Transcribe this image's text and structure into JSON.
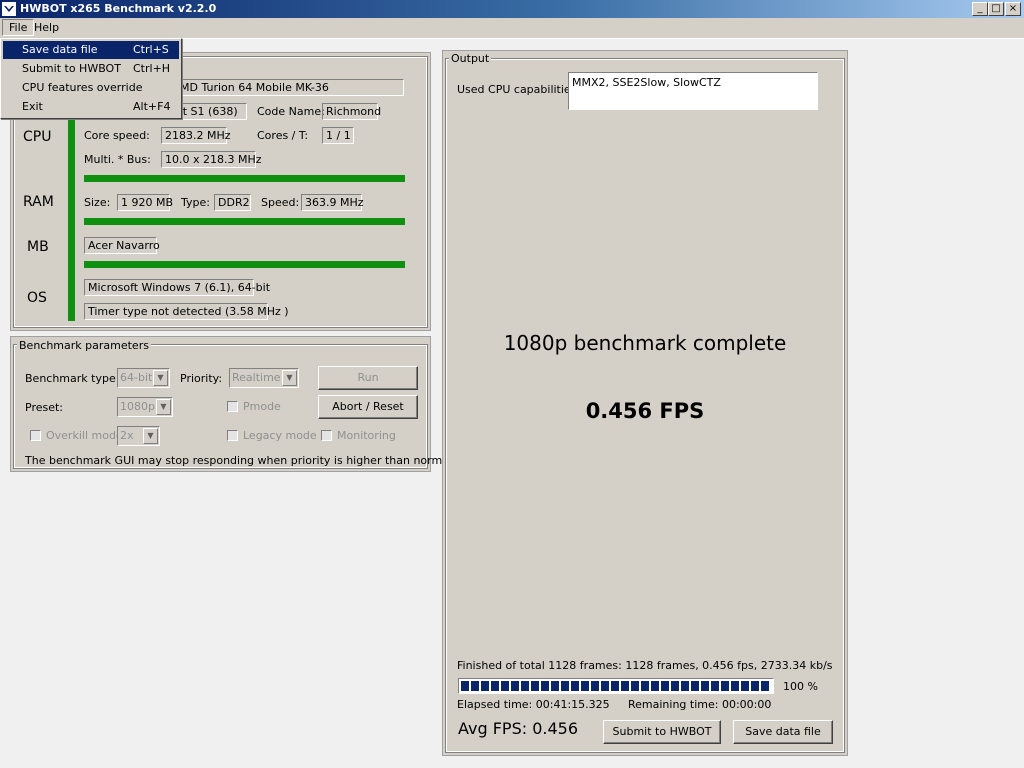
{
  "window": {
    "title": "HWBOT x265 Benchmark v2.2.0",
    "controls": {
      "minimize": "_",
      "maximize": "□",
      "close": "×"
    }
  },
  "menu": {
    "file": "File",
    "help": "Help",
    "file_items": [
      {
        "label": "Save data file",
        "shortcut": "Ctrl+S"
      },
      {
        "label": "Submit to HWBOT",
        "shortcut": "Ctrl+H"
      },
      {
        "label": "CPU features override",
        "shortcut": ""
      },
      {
        "label": "Exit",
        "shortcut": "Alt+F4"
      }
    ]
  },
  "system": {
    "sections": {
      "cpu": "CPU",
      "ram": "RAM",
      "mb": "MB",
      "os": "OS"
    },
    "cpu": {
      "name_visible": "MD Turion 64 Mobile MK-36",
      "socket_visible": "ket S1 (638)",
      "code_name_label": "Code Name:",
      "code_name": "Richmond",
      "core_speed_label": "Core speed:",
      "core_speed": "2183.2 MHz",
      "cores_label": "Cores / T:",
      "cores": "1 / 1",
      "multi_label": "Multi. * Bus:",
      "multi": "10.0 x 218.3 MHz"
    },
    "ram": {
      "size_label": "Size:",
      "size": "1 920 MB",
      "type_label": "Type:",
      "type": "DDR2",
      "speed_label": "Speed:",
      "speed": "363.9 MHz"
    },
    "mb": {
      "name": "Acer Navarro"
    },
    "os": {
      "name": "Microsoft Windows 7 (6.1), 64-bit",
      "timer": "Timer type not detected (3.58 MHz )"
    }
  },
  "benchmark": {
    "group_label": "Benchmark parameters",
    "type_label": "Benchmark type:",
    "type_value": "64-bit",
    "priority_label": "Priority:",
    "priority_value": "Realtime",
    "run_label": "Run",
    "preset_label": "Preset:",
    "preset_value": "1080p",
    "pmode_label": "Pmode",
    "abort_label": "Abort / Reset",
    "overkill_label": "Overkill mode",
    "overkill_value": "2x",
    "legacy_label": "Legacy mode",
    "monitoring_label": "Monitoring",
    "note": "The benchmark GUI may stop responding when priority is higher than normal."
  },
  "output": {
    "group_label": "Output",
    "caps_label": "Used CPU capabilities:",
    "caps_value": "MMX2, SSE2Slow, SlowCTZ",
    "complete_msg": "1080p benchmark complete",
    "fps_msg": "0.456 FPS",
    "finished_line": "Finished of total 1128 frames: 1128 frames, 0.456 fps,  2733.34 kb/s",
    "progress_percent": 100,
    "progress_label": "100 %",
    "elapsed": "Elapsed time: 00:41:15.325",
    "remaining": "Remaining time: 00:00:00",
    "avg_fps": "Avg FPS: 0.456",
    "submit_label": "Submit to HWBOT",
    "save_label": "Save data file"
  },
  "colors": {
    "accent_green": "#109010",
    "title_blue": "#0a246a",
    "progress_blue": "#0a246a"
  }
}
